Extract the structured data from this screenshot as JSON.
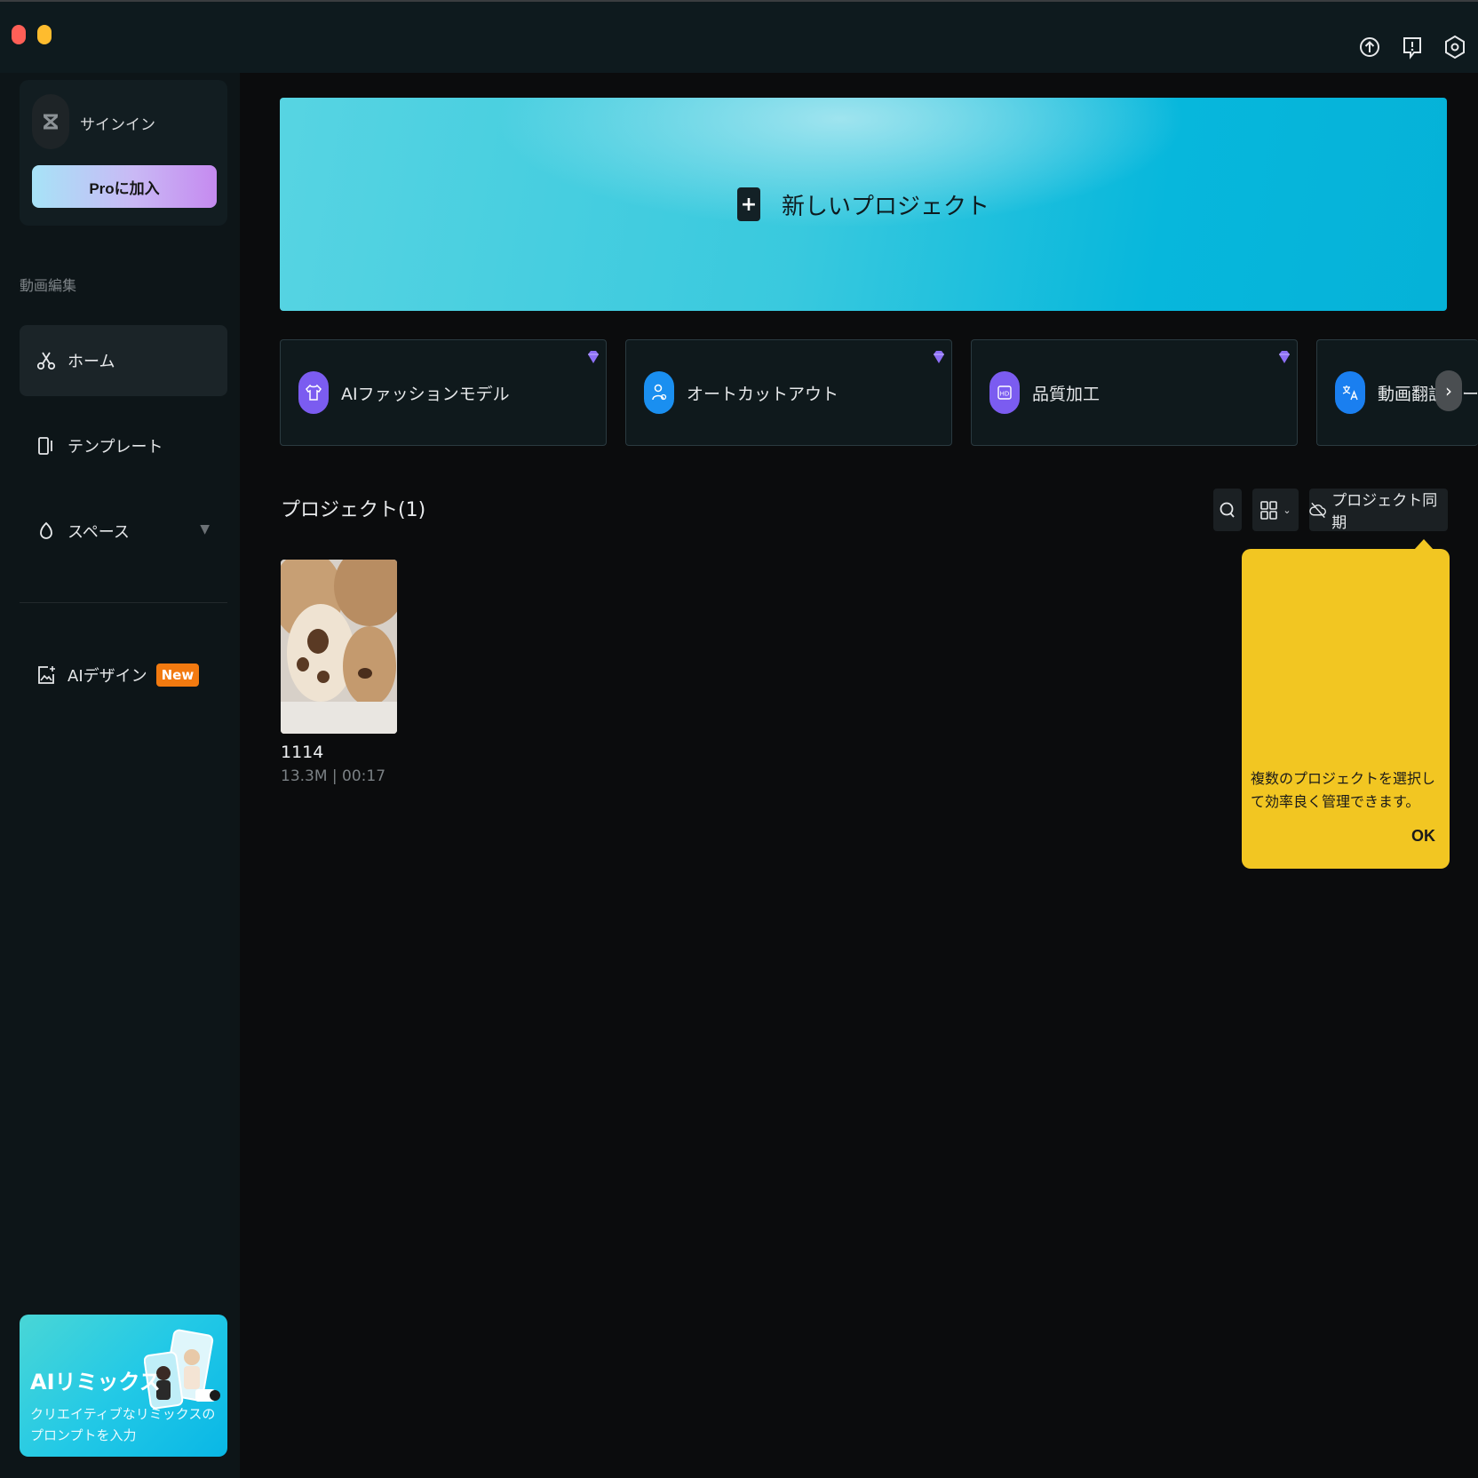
{
  "titlebar": {
    "icons": [
      "upload-icon",
      "feedback-icon",
      "settings-icon"
    ]
  },
  "sidebar": {
    "account": {
      "signin_label": "サインイン",
      "pro_button": "Proに加入"
    },
    "section_label": "動画編集",
    "nav": [
      {
        "label": "ホーム",
        "icon": "scissors-icon",
        "active": true
      },
      {
        "label": "テンプレート",
        "icon": "template-icon",
        "active": false
      },
      {
        "label": "スペース",
        "icon": "cloud-space-icon",
        "active": false
      }
    ],
    "ai_design": {
      "label": "AIデザイン",
      "badge": "New"
    },
    "promo": {
      "title": "AIリミックス",
      "subtitle": "クリエイティブなリミックスのプロンプトを入力"
    }
  },
  "main": {
    "hero": {
      "label": "新しいプロジェクト"
    },
    "tools": [
      {
        "label": "AIファッションモデル",
        "icon": "shirt-icon",
        "color": "#7b5cf0",
        "premium": true
      },
      {
        "label": "オートカットアウト",
        "icon": "person-cutout-icon",
        "color": "#1a8ff0",
        "premium": true
      },
      {
        "label": "品質加工",
        "icon": "hd-icon",
        "color": "#7b5cf0",
        "premium": true
      },
      {
        "label": "動画翻訳ツール",
        "icon": "translate-icon",
        "color": "#1a7ff0",
        "premium": false
      }
    ],
    "projects_title": "プロジェクト(1)",
    "sync_button": "プロジェクト同期",
    "projects": [
      {
        "name": "1114",
        "meta": "13.3M | 00:17"
      }
    ],
    "tooltip": {
      "text": "複数のプロジェクトを選択して効率良く管理できます。",
      "ok": "OK"
    }
  },
  "colors": {
    "accent_cyan": "#06b6dc",
    "tooltip_yellow": "#f2c622",
    "badge_orange": "#f27a10"
  }
}
